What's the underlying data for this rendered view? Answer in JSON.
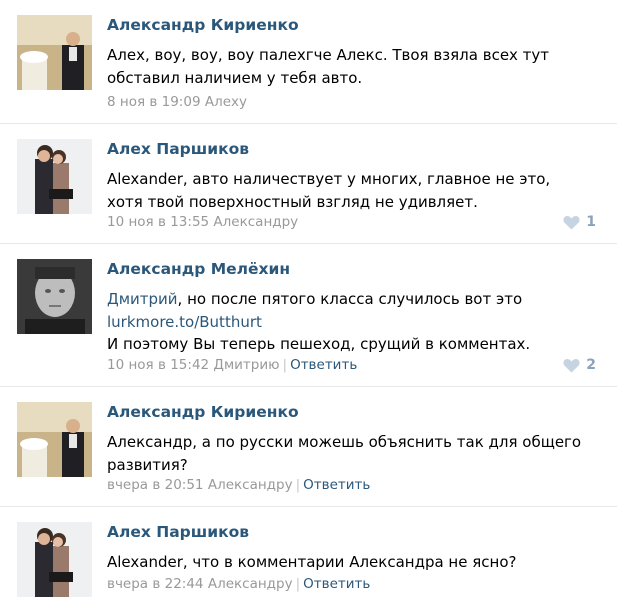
{
  "comments": [
    {
      "author": "Александр Кириенко",
      "avatar": "avatar-man-in-suit",
      "text": "Алех, воу, воу, воу палехгче Алекс. Твоя взяла всех тут обставил наличием у тебя авто.",
      "date": "8 ноя в 19:09",
      "reply_to": "Алеху",
      "reply_label": "",
      "likes": ""
    },
    {
      "author": "Алех Паршиков",
      "avatar": "avatar-couple",
      "text": "Alexander, авто наличествует у многих, главное не это, хотя твой поверхностный взгляд не удивляет.",
      "date": "10 ноя в 13:55",
      "reply_to": "Александру",
      "reply_label": "",
      "likes": "1"
    },
    {
      "author": "Александр Мелёхин",
      "avatar": "avatar-portrait-bw",
      "mention": "Дмитрий",
      "text_after_mention": ", но после пятого класса случилось вот это",
      "link": "lurkmore.to/Butthurt",
      "text_line3": "И поэтому Вы теперь пешеход, срущий в комментах.",
      "date": "10 ноя в 15:42",
      "reply_to": "Дмитрию",
      "reply_label": "Ответить",
      "likes": "2"
    },
    {
      "author": "Александр Кириенко",
      "avatar": "avatar-man-in-suit",
      "text": "Александр, а по русски можешь объяснить так для общего развития?",
      "date": "вчера в 20:51",
      "reply_to": "Александру",
      "reply_label": "Ответить",
      "likes": ""
    },
    {
      "author": "Алех Паршиков",
      "avatar": "avatar-couple",
      "text": "Alexander, что в комментарии Александра не ясно?",
      "date": "вчера в 22:44",
      "reply_to": "Александру",
      "reply_label": "Ответить",
      "likes": ""
    }
  ],
  "colors": {
    "author": "#2b587a",
    "meta": "#999999",
    "like": "#8ba2bd",
    "divider": "#e7e8ec"
  },
  "icons": {
    "like": "heart-icon"
  }
}
